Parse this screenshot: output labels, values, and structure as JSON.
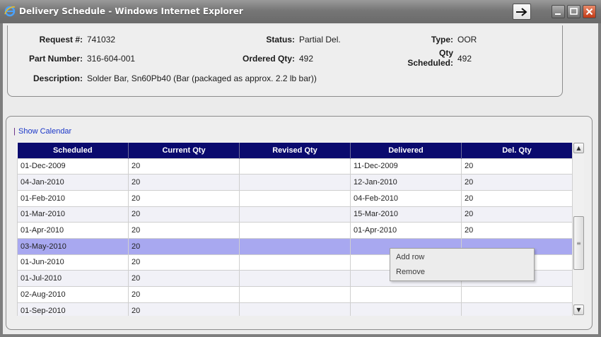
{
  "window": {
    "title": "Delivery Schedule - Windows Internet Explorer"
  },
  "info": {
    "request_label": "Request #:",
    "request_value": "741032",
    "status_label": "Status:",
    "status_value": "Partial Del.",
    "type_label": "Type:",
    "type_value": "OOR",
    "part_label": "Part Number:",
    "part_value": "316-604-001",
    "ordered_label": "Ordered Qty:",
    "ordered_value": "492",
    "qty_sched_label_1": "Qty",
    "qty_sched_label_2": "Scheduled:",
    "qty_sched_value": "492",
    "desc_label": "Description:",
    "desc_value": "Solder Bar, Sn60Pb40 (Bar (packaged as approx. 2.2 lb bar))"
  },
  "calendar": {
    "separator": "|",
    "link_label": "Show Calendar"
  },
  "table": {
    "headers": [
      "Scheduled",
      "Current Qty",
      "Revised Qty",
      "Delivered",
      "Del. Qty"
    ],
    "rows": [
      [
        "01-Dec-2009",
        "20",
        "",
        "11-Dec-2009",
        "20"
      ],
      [
        "04-Jan-2010",
        "20",
        "",
        "12-Jan-2010",
        "20"
      ],
      [
        "01-Feb-2010",
        "20",
        "",
        "04-Feb-2010",
        "20"
      ],
      [
        "01-Mar-2010",
        "20",
        "",
        "15-Mar-2010",
        "20"
      ],
      [
        "01-Apr-2010",
        "20",
        "",
        "01-Apr-2010",
        "20"
      ],
      [
        "03-May-2010",
        "20",
        "",
        "",
        ""
      ],
      [
        "01-Jun-2010",
        "20",
        "",
        "",
        ""
      ],
      [
        "01-Jul-2010",
        "20",
        "",
        "",
        ""
      ],
      [
        "02-Aug-2010",
        "20",
        "",
        "",
        ""
      ],
      [
        "01-Sep-2010",
        "20",
        "",
        "",
        ""
      ]
    ],
    "selected_row": 5
  },
  "context_menu": {
    "items": [
      "Add row",
      "Remove"
    ]
  },
  "colors": {
    "header_bg": "#0a0a6e",
    "selected_row_bg": "#a8a8f0",
    "link": "#1a36c8"
  },
  "icons": [
    "ie-logo-icon",
    "go-arrow-icon",
    "minimize-icon",
    "maximize-icon",
    "close-icon",
    "scroll-up-icon",
    "scroll-down-icon"
  ]
}
